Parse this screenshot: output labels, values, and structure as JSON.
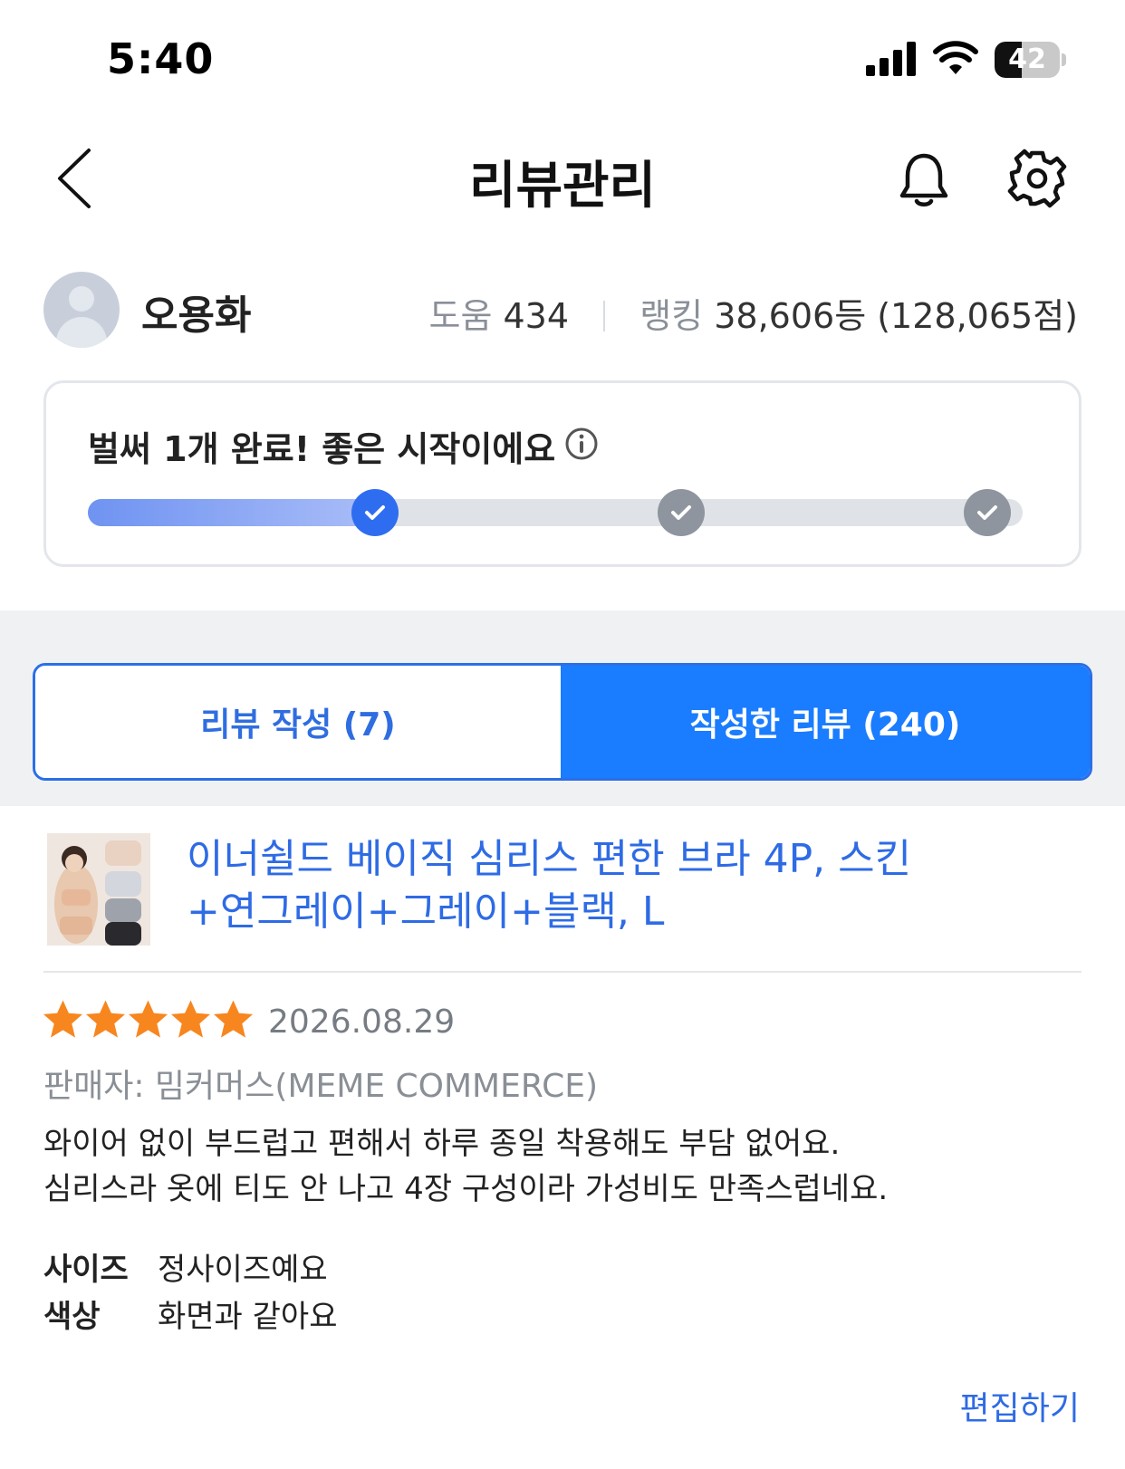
{
  "status_bar": {
    "time": "5:40",
    "battery": "42",
    "battery_level": 0.42
  },
  "header": {
    "title": "리뷰관리",
    "icons": [
      "back-icon",
      "bell-icon",
      "gear-icon"
    ]
  },
  "profile": {
    "name": "오용화",
    "help_label": "도움",
    "help_value": "434",
    "ranking_label": "랭킹",
    "ranking_value": "38,606등 (128,065점)"
  },
  "progress": {
    "title": "벌써 1개 완료! 좋은 시작이에요",
    "steps_total": 3,
    "steps_done": 1,
    "fill_fraction": 0.31
  },
  "tabs": [
    {
      "label": "리뷰 작성 (7)",
      "active": false
    },
    {
      "label": "작성한 리뷰 (240)",
      "active": true
    }
  ],
  "review": {
    "product_name_line1": "이너쉴드 베이직 심리스 편한 브라 4P, 스킨",
    "product_name_line2": "+연그레이+그레이+블랙, L",
    "rating": 5,
    "date": "2026.08.29",
    "seller": "판매자: 밈커머스(MEME COMMERCE)",
    "text": "와이어 없이 부드럽고 편해서 하루 종일 착용해도 부담 없어요.\n심리스라 옷에 티도 안 나고 4장 구성이라 가성비도 만족스럽네요.",
    "attributes": [
      {
        "key": "사이즈",
        "value": "정사이즈예요"
      },
      {
        "key": "색상",
        "value": "화면과 같아요"
      }
    ],
    "edit_label": "편집하기"
  },
  "colors": {
    "accent": "#1a7cff",
    "link": "#2e6be5",
    "star": "#f7861f"
  }
}
